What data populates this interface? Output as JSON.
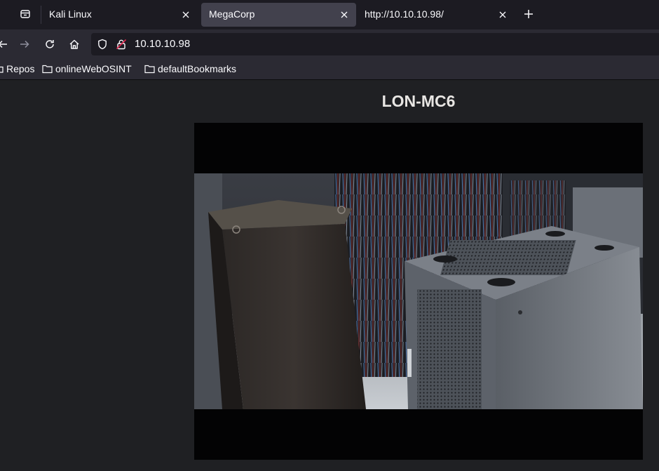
{
  "tabs": [
    {
      "label": "Kali Linux",
      "active": false
    },
    {
      "label": "MegaCorp",
      "active": true
    },
    {
      "label": "http://10.10.10.98/",
      "active": false
    }
  ],
  "icons": {
    "tab_list": "tab-list-icon",
    "close": "close-icon",
    "new_tab": "plus-icon",
    "back": "arrow-left-icon",
    "forward": "arrow-right-icon",
    "reload": "reload-icon",
    "home": "home-icon",
    "tracking": "shield-icon",
    "insecure": "lock-insecure-icon",
    "folder": "folder-icon"
  },
  "url": "10.10.10.98",
  "bookmarks": [
    "Repos",
    "onlineWebOSINT",
    "defaultBookmarks"
  ],
  "page": {
    "title": "LON-MC6",
    "video": {
      "alt": "Camera feed of server room racks"
    }
  },
  "colors": {
    "toolbar": "#2b2a33",
    "tabbar": "#1c1b22",
    "active_tab": "#42414d",
    "page_bg": "#1f2023",
    "insecure_lock": "#e22850"
  }
}
